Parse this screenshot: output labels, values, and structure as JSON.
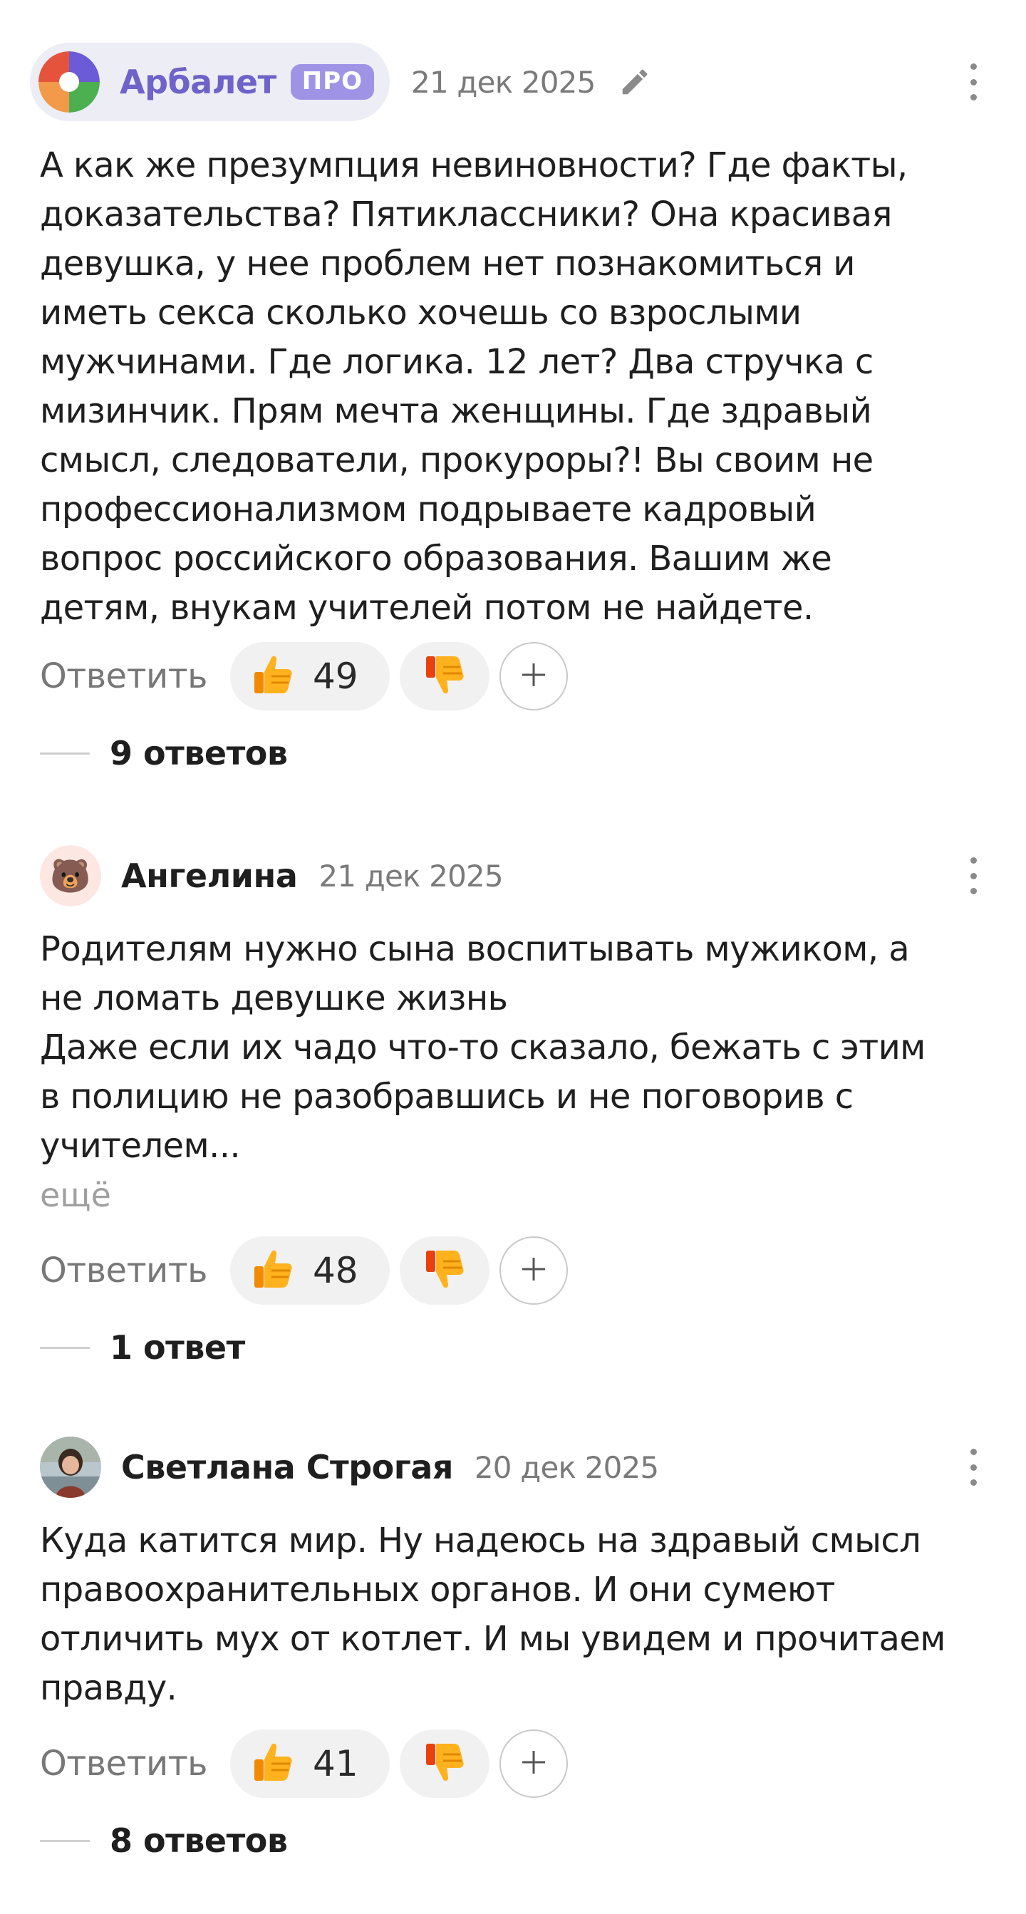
{
  "comments": [
    {
      "author": "Арбалет",
      "badge": "ПРО",
      "date": "21 дек 2025",
      "text": "А как же презумпция невиновности? Где факты,\nдоказательства? Пятиклассники? Она красивая\nдевушка, у нее проблем нет познакомиться и\nиметь секса сколько хочешь со взрослыми\nмужчинами. Где логика. 12 лет? Два стручка с\nмизинчик. Прям мечта женщины. Где здравый\nсмысл, следователи, прокуроры?! Вы своим не\nпрофессионализмом подрываете кадровый\nвопрос российского образования. Вашим же\nдетям, внукам учителей потом не найдете.",
      "reply_label": "Ответить",
      "likes": "49",
      "replies": "9 ответов"
    },
    {
      "author": "Ангелина",
      "avatar_icon": "bear-emoji",
      "avatar_emoji": "🐻",
      "date": "21 дек 2025",
      "text": "Родителям нужно сына воспитывать мужиком, а\nне ломать девушке жизнь\nДаже если их чадо что-то сказало, бежать с этим\nв полицию не разобравшись и не поговорив с\nучителем...",
      "more": "ещё",
      "reply_label": "Ответить",
      "likes": "48",
      "replies": "1 ответ"
    },
    {
      "author": "Светлана Строгая",
      "date": "20 дек 2025",
      "text": "Куда катится мир. Ну надеюсь на здравый смысл\nправоохранительных органов. И они сумеют\nотличить мух от котлет. И мы увидем и прочитаем\nправду.",
      "reply_label": "Ответить",
      "likes": "41",
      "replies": "8 ответов"
    }
  ],
  "colors": {
    "brand_name": "#6e63c8",
    "pro_badge": "#9f93e6",
    "chip_bg": "#ededf6",
    "pill_bg": "#f1f1f1",
    "muted_text": "#777777"
  },
  "icons": [
    "brand-logo-icon",
    "pencil-icon",
    "more-vertical-icon",
    "thumbs-up-icon",
    "thumbs-down-icon",
    "plus-icon"
  ]
}
